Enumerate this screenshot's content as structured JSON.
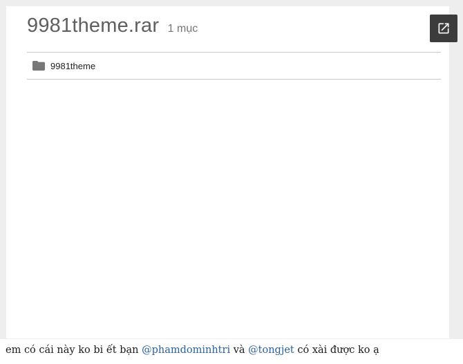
{
  "embed": {
    "title": "9981theme.rar",
    "item_count": "1 mục",
    "open_button_icon": "open-in-new-icon",
    "items": [
      {
        "icon": "folder-icon",
        "label": "9981theme"
      }
    ]
  },
  "message": {
    "part1": "em có cái này ko bi ết bạn ",
    "mention1": "@phamdominhtri",
    "part2": " và ",
    "mention2": "@tongjet",
    "part3": " có xài được ko ạ"
  },
  "colors": {
    "frame_bg": "#eeeeee",
    "button_bg": "#3c3c3c",
    "mention": "#2a5f9e"
  }
}
